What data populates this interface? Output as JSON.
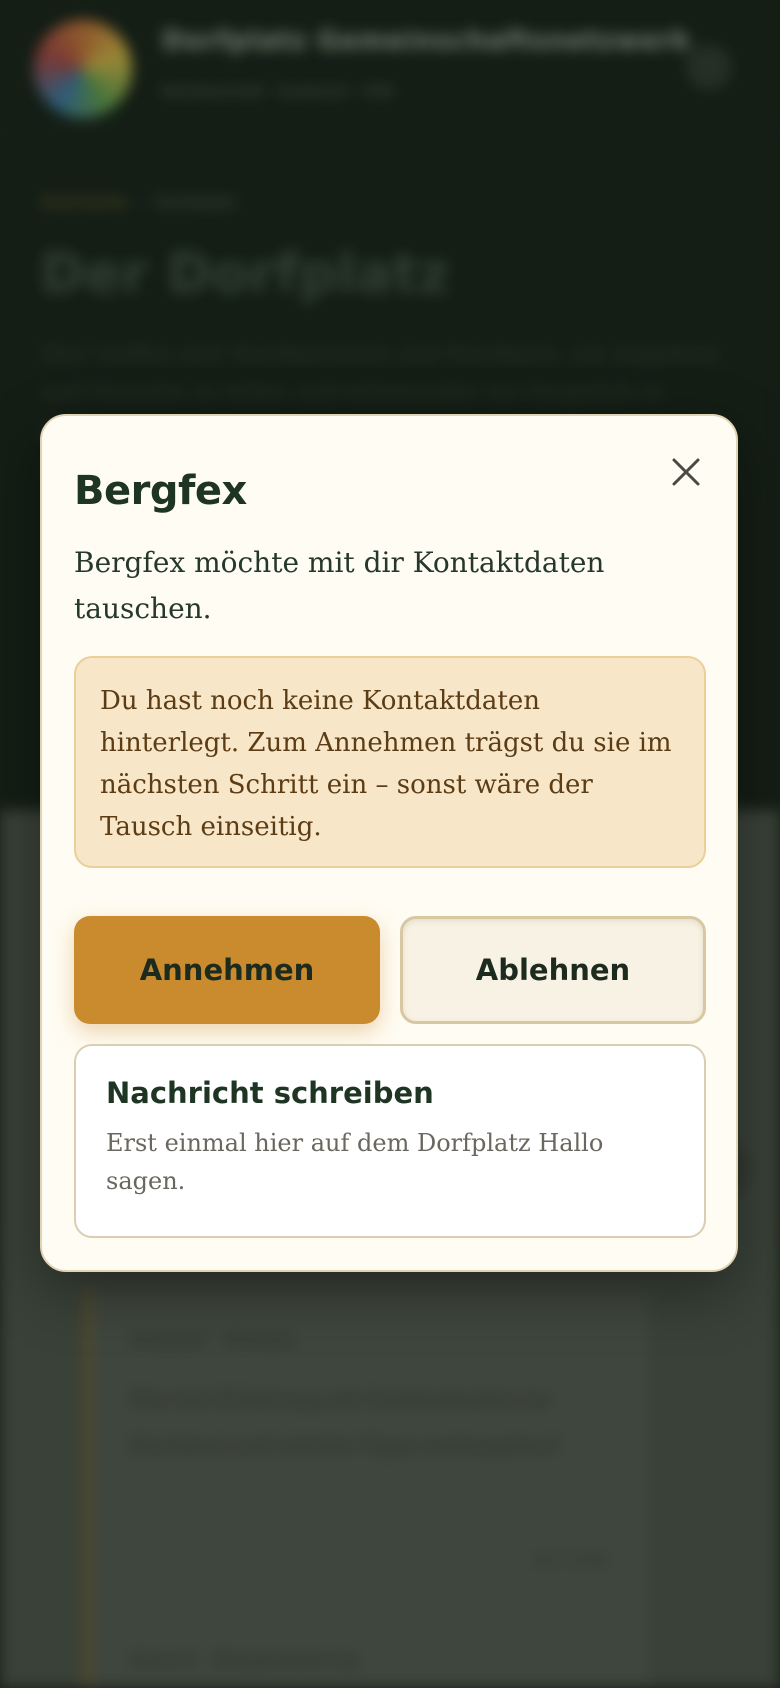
{
  "background": {
    "site_title": "Dorfplatz Gemeinschaftsnetzwerk",
    "tagline": "Nachbarschaft · Austausch · Hilfe",
    "breadcrumb": {
      "home": "Startseite",
      "current": "Dorfplatz"
    },
    "page_title": "Der Dorfplatz",
    "intro": "Hier treffen sich Nachbarinnen und Nachbarn, um Angebote und Gesuche zu teilen und miteinander ins Gespräch zu kommen.",
    "post": {
      "meta": "Anbieter · Hinweis",
      "body": "Wer hat Erfahrung mit Gemüsebeeten im Hochbeet und möchte Tipps weitergeben?",
      "time": "vor 2 Std.",
      "next_meta": "Gesuch · Bergwanderung"
    }
  },
  "modal": {
    "title": "Bergfex",
    "text": "Bergfex möchte mit dir Kontaktdaten tauschen.",
    "notice": "Du hast noch keine Kontaktdaten hinterlegt. Zum Annehmen trägst du sie im nächsten Schritt ein – sonst wäre der Tausch einseitig.",
    "accept_label": "Annehmen",
    "decline_label": "Ablehnen",
    "message_title": "Nachricht schreiben",
    "message_sub": "Erst einmal hier auf dem Dorfplatz Hallo sagen.",
    "close_icon": "close-icon"
  },
  "colors": {
    "accent": "#c98b2e",
    "primary_text": "#1f3524",
    "notice_bg": "#f7e6c7",
    "modal_bg": "#fffcf3"
  }
}
